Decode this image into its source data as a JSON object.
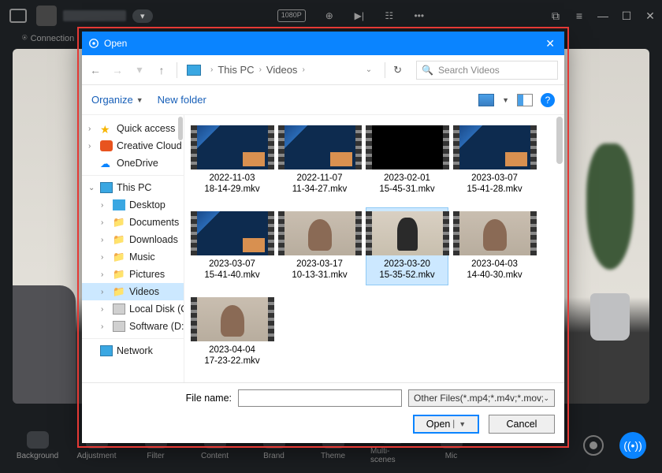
{
  "host": {
    "connection": "Connection",
    "badge": "1080P",
    "toolbar": [
      "Background",
      "Adjustment",
      "Filter",
      "Content",
      "Brand",
      "Theme",
      "Multi-scenes",
      "Mic"
    ]
  },
  "dialog": {
    "title": "Open",
    "nav": {
      "crumb1": "This PC",
      "crumb2": "Videos",
      "search_placeholder": "Search Videos"
    },
    "toolbar": {
      "organize": "Organize",
      "new_folder": "New folder"
    },
    "tree": [
      {
        "label": "Quick access",
        "depth": 0,
        "tw": "›",
        "icon": "star"
      },
      {
        "label": "Creative Cloud Files",
        "depth": 0,
        "tw": "›",
        "icon": "cc"
      },
      {
        "label": "OneDrive",
        "depth": 0,
        "tw": "",
        "icon": "cloud"
      },
      {
        "hr": true
      },
      {
        "label": "This PC",
        "depth": 0,
        "tw": "⌄",
        "icon": "monitor"
      },
      {
        "label": "Desktop",
        "depth": 1,
        "tw": "›",
        "icon": "desktop"
      },
      {
        "label": "Documents",
        "depth": 1,
        "tw": "›",
        "icon": "folder"
      },
      {
        "label": "Downloads",
        "depth": 1,
        "tw": "›",
        "icon": "folder"
      },
      {
        "label": "Music",
        "depth": 1,
        "tw": "›",
        "icon": "folder"
      },
      {
        "label": "Pictures",
        "depth": 1,
        "tw": "›",
        "icon": "folder"
      },
      {
        "label": "Videos",
        "depth": 1,
        "tw": "›",
        "icon": "folder",
        "sel": true
      },
      {
        "label": "Local Disk (C:)",
        "depth": 1,
        "tw": "›",
        "icon": "drive"
      },
      {
        "label": "Software (D:)",
        "depth": 1,
        "tw": "›",
        "icon": "drive"
      },
      {
        "hr": true
      },
      {
        "label": "Network",
        "depth": 0,
        "tw": "",
        "icon": "monitor"
      }
    ],
    "files": [
      {
        "l1": "2022-11-03",
        "l2": "18-14-29.mkv",
        "shot": "app"
      },
      {
        "l1": "2022-11-07",
        "l2": "11-34-27.mkv",
        "shot": "app"
      },
      {
        "l1": "2023-02-01",
        "l2": "15-45-31.mkv",
        "shot": "dark"
      },
      {
        "l1": "2023-03-07",
        "l2": "15-41-28.mkv",
        "shot": "app"
      },
      {
        "l1": "2023-03-07",
        "l2": "15-41-40.mkv",
        "shot": "app"
      },
      {
        "l1": "2023-03-17",
        "l2": "10-13-31.mkv",
        "shot": "woman"
      },
      {
        "l1": "2023-03-20",
        "l2": "15-35-52.mkv",
        "shot": "man",
        "sel": true
      },
      {
        "l1": "2023-04-03",
        "l2": "14-40-30.mkv",
        "shot": "woman"
      },
      {
        "l1": "2023-04-04",
        "l2": "17-23-22.mkv",
        "shot": "woman"
      }
    ],
    "bottom": {
      "filename_label": "File name:",
      "filter": "Other Files(*.mp4;*.m4v;*.mov;",
      "open": "Open",
      "cancel": "Cancel"
    }
  }
}
